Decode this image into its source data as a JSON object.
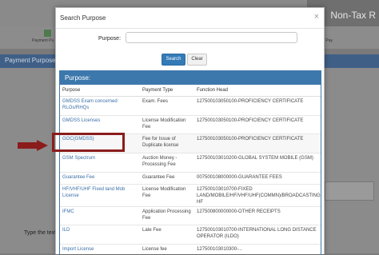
{
  "background": {
    "title_partial": "Non-Tax R",
    "step_label": "Payment Pu",
    "step_label_right": "Pay",
    "bar_label": "Payment Purpose",
    "type_label": "Type the text"
  },
  "modal": {
    "title": "Search Purpose",
    "close": "×",
    "search_label": "Purpose:",
    "search_value": "",
    "search_button": "Search",
    "clear_button": "Clear"
  },
  "panel": {
    "title": "Purpose:",
    "columns": [
      "Purpose",
      "Payment Type",
      "Function Head"
    ],
    "rows": [
      {
        "purpose": "GMDSS Exam concerned RLOs/RHQs",
        "type": "Exam. Fees",
        "head": "127500103050100-PROFICIENCY CERTIFICATE"
      },
      {
        "purpose": "GMDSS Licenses",
        "type": "License Modification Fee",
        "head": "127500103050100-PROFICIENCY CERTIFICATE"
      },
      {
        "purpose": "GOC(GMDSS)",
        "type": "Fee for Issue of Duplicate license",
        "head": "127500103050100-PROFICIENCY CERTIFICATE"
      },
      {
        "purpose": "GSM Spectrum",
        "type": "Auction Money - Processing Fee",
        "head": "127500103010200-GLOBAL SYSTEM MOBILE (GSM)"
      },
      {
        "purpose": "Guarantee Fee",
        "type": "Guarantee Fee",
        "head": "007500108000000-GUARANTEE FEES"
      },
      {
        "purpose": "HF/VHF/UHF Fixed land Mob License",
        "type": "License Modification Fee",
        "head": "127500103010700-FIXED LAND/MOBILE/HF/VHF/UHF(COMMN)/BROADCASTING HF"
      },
      {
        "purpose": "IFMC",
        "type": "Application Processing Fee",
        "head": "127500800000000-OTHER RECEIPTS"
      },
      {
        "purpose": "ILD",
        "type": "Late Fee",
        "head": "127500103010700-INTERNATIONAL LONG DISTANCE OPERATOR (ILDO)"
      },
      {
        "purpose": "Import License",
        "type": "License fee",
        "head": "127500103010300-..."
      }
    ]
  },
  "colors": {
    "accent": "#3d78ad",
    "highlight": "#8b1c1c",
    "link": "#3a6fa8"
  }
}
